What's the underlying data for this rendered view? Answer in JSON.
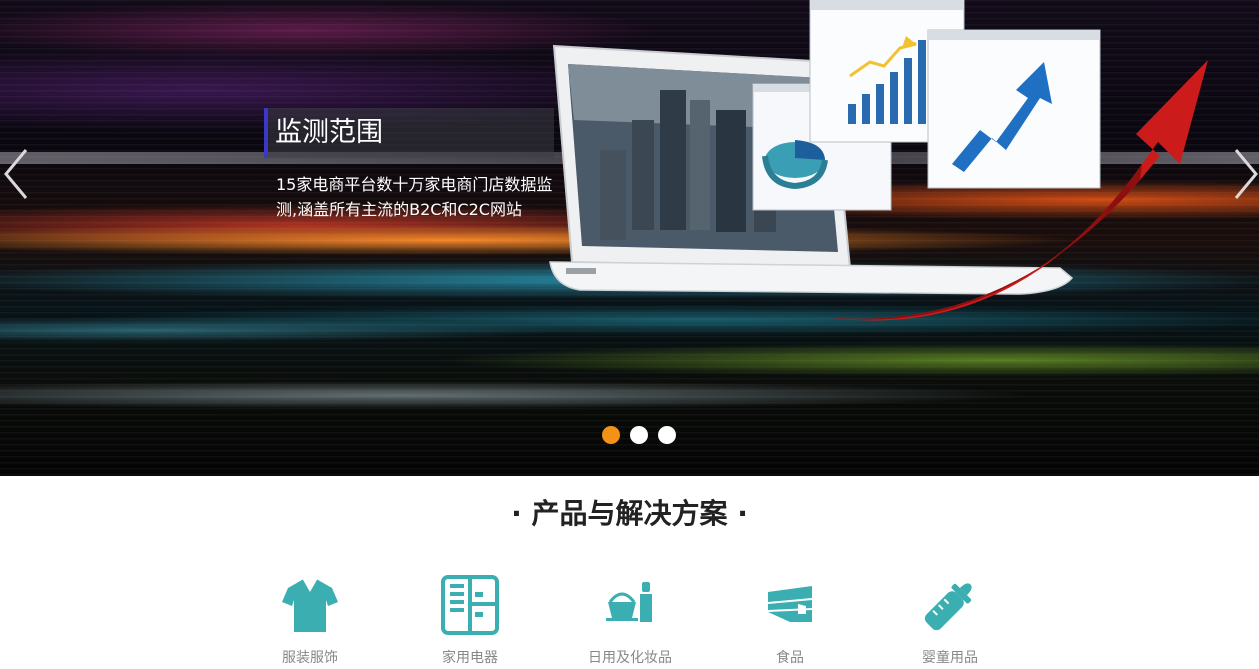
{
  "banner": {
    "title": "监测范围",
    "description": "15家电商平台数十万家电商门店数据监测,涵盖所有主流的B2C和C2C网站",
    "dots": [
      {
        "active": true,
        "color": "#f39217"
      },
      {
        "active": false,
        "color": "#ffffff"
      },
      {
        "active": false,
        "color": "#ffffff"
      }
    ]
  },
  "section": {
    "title": "· 产品与解决方案 ·"
  },
  "products": [
    {
      "label": "服装服饰",
      "icon": "shirt-icon"
    },
    {
      "label": "家用电器",
      "icon": "refrigerator-icon"
    },
    {
      "label": "日用及化妆品",
      "icon": "cosmetics-icon"
    },
    {
      "label": "食品",
      "icon": "cake-icon"
    },
    {
      "label": "婴童用品",
      "icon": "baby-bottle-icon"
    }
  ],
  "colors": {
    "accent_teal": "#3aaeb0",
    "dot_active": "#f39217",
    "title_bar": "#3b38c8"
  }
}
